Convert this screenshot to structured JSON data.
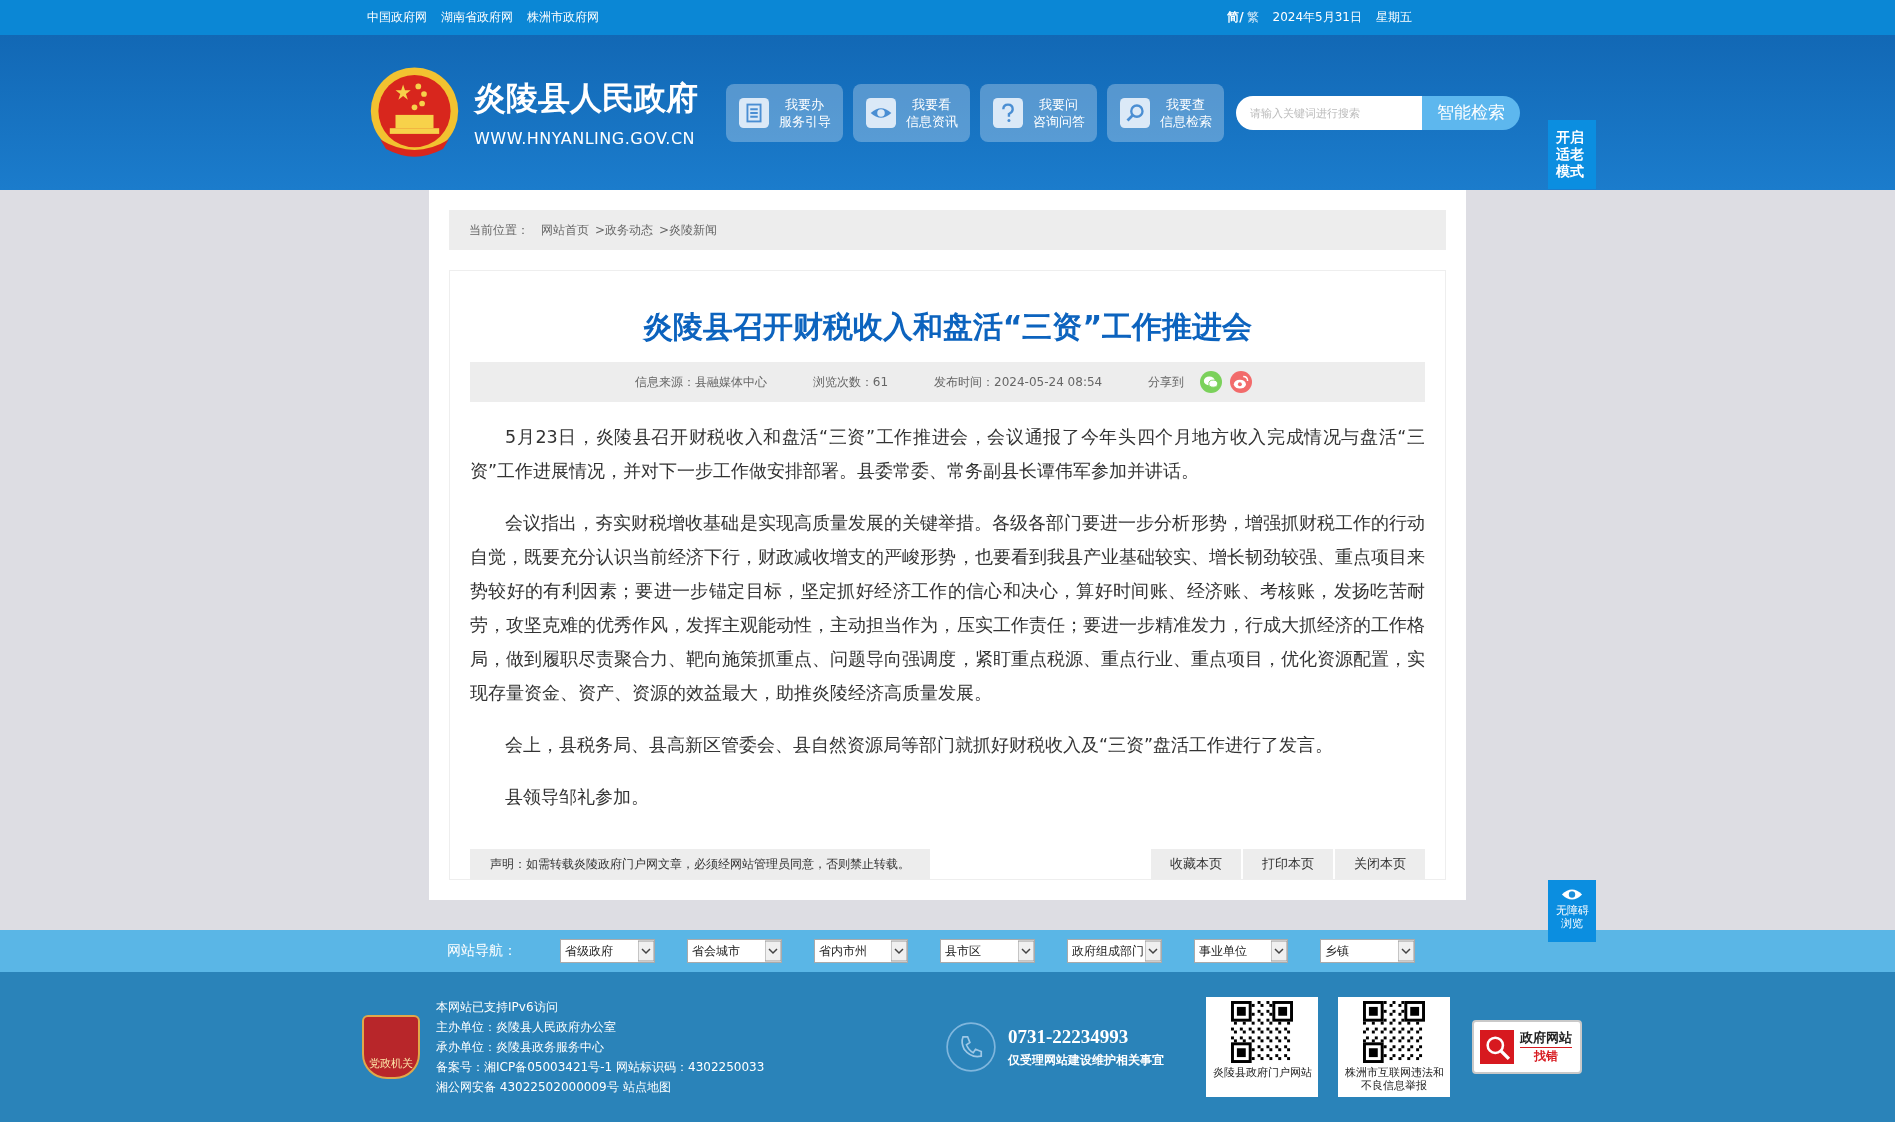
{
  "top_bar": {
    "links": [
      "中国政府网",
      "湖南省政府网",
      "株洲市政府网"
    ],
    "languages": [
      {
        "label": "简/",
        "selected": true
      },
      {
        "label": "繁",
        "selected": false
      }
    ],
    "date": "2024年5月31日",
    "weekday": "星期五"
  },
  "header": {
    "site_name": "炎陵县人民政府",
    "site_url": "WWW.HNYANLING.GOV.CN",
    "quick_links": [
      {
        "kind": "document",
        "title": "我要办",
        "subtitle": "服务引导"
      },
      {
        "kind": "eye",
        "title": "我要看",
        "subtitle": "信息资讯"
      },
      {
        "kind": "question",
        "title": "我要问",
        "subtitle": "咨询问答"
      },
      {
        "kind": "search",
        "title": "我要查",
        "subtitle": "信息检索"
      }
    ],
    "search": {
      "placeholder": "请输入关键词进行搜索",
      "button": "智能检索"
    }
  },
  "elder_mode_button": "开启适老模式",
  "breadcrumb": {
    "label": "当前位置：",
    "items": [
      "网站首页",
      ">政务动态",
      ">炎陵新闻"
    ]
  },
  "article": {
    "title": "炎陵县召开财税收入和盘活“三资”工作推进会",
    "meta": [
      "信息来源：县融媒体中心",
      "浏览次数：61",
      "发布时间：2024-05-24 08:54"
    ],
    "share_label": "分享到",
    "paragraphs": [
      "5月23日，炎陵县召开财税收入和盘活“三资”工作推进会，会议通报了今年头四个月地方收入完成情况与盘活“三资”工作进展情况，并对下一步工作做安排部署。县委常委、常务副县长谭伟军参加并讲话。",
      "会议指出，夯实财税增收基础是实现高质量发展的关键举措。各级各部门要进一步分析形势，增强抓财税工作的行动自觉，既要充分认识当前经济下行，财政减收增支的严峻形势，也要看到我县产业基础较实、增长韧劲较强、重点项目来势较好的有利因素；要进一步锚定目标，坚定抓好经济工作的信心和决心，算好时间账、经济账、考核账，发扬吃苦耐劳，攻坚克难的优秀作风，发挥主观能动性，主动担当作为，压实工作责任；要进一步精准发力，行成大抓经济的工作格局，做到履职尽责聚合力、靶向施策抓重点、问题导向强调度，紧盯重点税源、重点行业、重点项目，优化资源配置，实现存量资金、资产、资源的效益最大，助推炎陵经济高质量发展。",
      "会上，县税务局、县高新区管委会、县自然资源局等部门就抓好财税收入及“三资”盘活工作进行了发言。",
      "县领导邹礼参加。"
    ],
    "statement": "声明：如需转载炎陵政府门户网文章，必须经网站管理员同意，否则禁止转载。",
    "actions": [
      "收藏本页",
      "打印本页",
      "关闭本页"
    ]
  },
  "accessibility_button": "无障碍浏览",
  "footer_nav": {
    "label": "网站导航：",
    "selects": [
      "省级政府",
      "省会城市",
      "省内市州",
      "县市区",
      "政府组成部门",
      "事业单位",
      "乡镇"
    ]
  },
  "footer": {
    "badge": "党政机关",
    "lines": [
      "本网站已支持IPv6访问",
      "主办单位：炎陵县人民政府办公室",
      "承办单位：炎陵县政务服务中心",
      "备案号：湘ICP备05003421号-1 网站标识码：4302250033",
      "湘公网安备 43022502000009号 站点地图"
    ],
    "phone": "0731-22234993",
    "phone_note": "仅受理网站建设维护相关事宜",
    "qr_codes": [
      {
        "caption": "炎陵县政府门户网站"
      },
      {
        "caption": "株洲市互联网违法和不良信息举报"
      }
    ],
    "report_badge": {
      "title": "政府网站",
      "action": "找错"
    }
  }
}
